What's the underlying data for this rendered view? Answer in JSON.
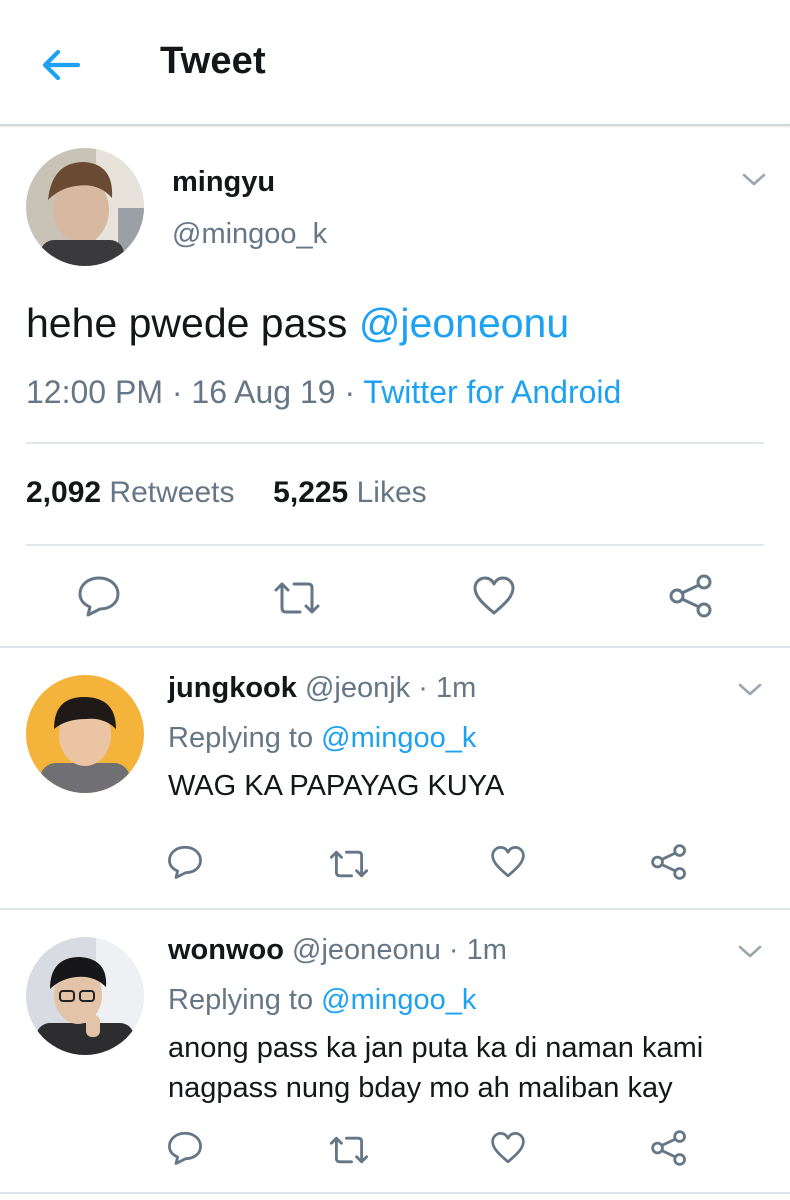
{
  "header": {
    "title": "Tweet",
    "back_icon": "arrow-left-icon",
    "accent": "#1da1f2"
  },
  "tweet": {
    "name": "mingyu",
    "handle": "@mingoo_k",
    "text": "hehe pwede pass ",
    "mention": "@jeoneonu",
    "time": "12:00 PM · 16 Aug 19 · ",
    "source": "Twitter for Android",
    "retweets_count": "2,092",
    "retweets_label": "Retweets",
    "likes_count": "5,225",
    "likes_label": "Likes"
  },
  "replies": [
    {
      "name": "jungkook",
      "handle": "@jeonjk",
      "time": "· 1m",
      "replying_prefix": "Replying to ",
      "replying_to": "@mingoo_k",
      "text": "WAG KA PAPAYAG KUYA"
    },
    {
      "name": "wonwoo",
      "handle": "@jeoneonu",
      "time": "· 1m",
      "replying_prefix": "Replying to ",
      "replying_to": "@mingoo_k",
      "text": "anong pass ka jan puta ka di naman kami nagpass nung bday mo ah maliban kay"
    }
  ],
  "colors": {
    "text": "#14171a",
    "muted": "#657786",
    "link": "#1da1f2",
    "divider": "#e1e8ed"
  }
}
